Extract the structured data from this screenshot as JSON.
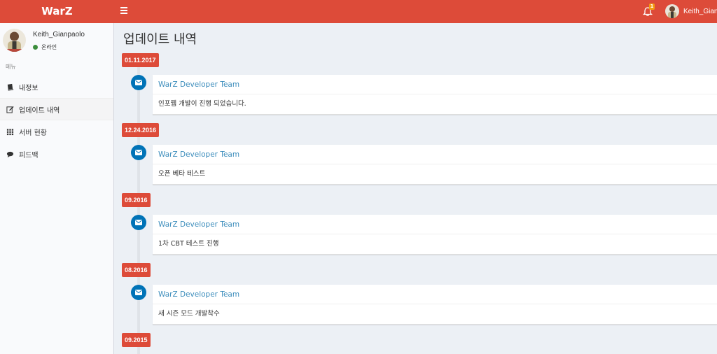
{
  "app": {
    "brand": "WarZ"
  },
  "header": {
    "notification_count": "1",
    "user_name": "Keith_Gian"
  },
  "sidebar": {
    "user_name": "Keith_Gianpaolo",
    "status": "온라인",
    "menu_header": "메뉴",
    "items": [
      {
        "label": "내정보",
        "icon": "book-icon"
      },
      {
        "label": "업데이트 내역",
        "icon": "edit-icon"
      },
      {
        "label": "서버 현황",
        "icon": "grid-icon"
      },
      {
        "label": "피드백",
        "icon": "comment-icon"
      }
    ]
  },
  "page": {
    "title": "업데이트 내역"
  },
  "timeline": [
    {
      "date": "01.11.2017",
      "author": "WarZ Developer Team",
      "body": "인포웹 개발이 진행 되었습니다."
    },
    {
      "date": "12.24.2016",
      "author": "WarZ Developer Team",
      "body": "오픈 베타 테스트"
    },
    {
      "date": "09.2016",
      "author": "WarZ Developer Team",
      "body": "1차 CBT 테스트 진행"
    },
    {
      "date": "08.2016",
      "author": "WarZ Developer Team",
      "body": "새 시즌 모드 개발착수"
    },
    {
      "date": "09.2015"
    }
  ],
  "colors": {
    "header": "#dd4b39",
    "timeline_icon": "#0073b7",
    "link": "#3c8dbc",
    "badge": "#f39c12",
    "online": "#3c8d3c"
  }
}
